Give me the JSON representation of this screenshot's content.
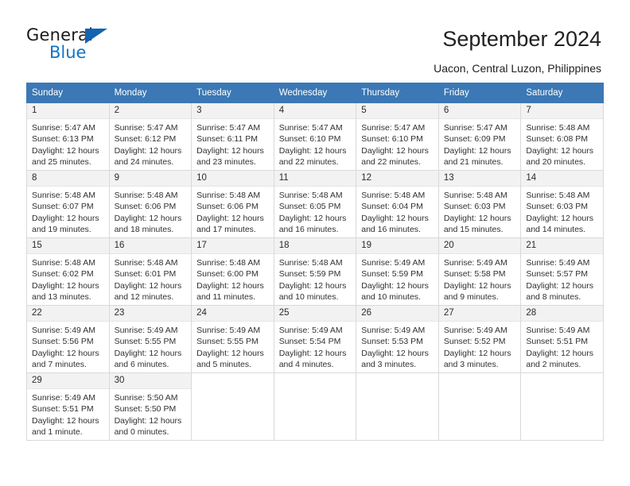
{
  "brand": {
    "name_top": "General",
    "name_bottom": "Blue",
    "accent_color": "#1273c7",
    "triangle_color": "#1263b0"
  },
  "header": {
    "title": "September 2024",
    "subtitle": "Uacon, Central Luzon, Philippines"
  },
  "calendar": {
    "header_color": "#3b78b5",
    "weekdays": [
      "Sunday",
      "Monday",
      "Tuesday",
      "Wednesday",
      "Thursday",
      "Friday",
      "Saturday"
    ],
    "weeks": [
      [
        {
          "day": "1",
          "sunrise": "Sunrise: 5:47 AM",
          "sunset": "Sunset: 6:13 PM",
          "daylight": "Daylight: 12 hours and 25 minutes."
        },
        {
          "day": "2",
          "sunrise": "Sunrise: 5:47 AM",
          "sunset": "Sunset: 6:12 PM",
          "daylight": "Daylight: 12 hours and 24 minutes."
        },
        {
          "day": "3",
          "sunrise": "Sunrise: 5:47 AM",
          "sunset": "Sunset: 6:11 PM",
          "daylight": "Daylight: 12 hours and 23 minutes."
        },
        {
          "day": "4",
          "sunrise": "Sunrise: 5:47 AM",
          "sunset": "Sunset: 6:10 PM",
          "daylight": "Daylight: 12 hours and 22 minutes."
        },
        {
          "day": "5",
          "sunrise": "Sunrise: 5:47 AM",
          "sunset": "Sunset: 6:10 PM",
          "daylight": "Daylight: 12 hours and 22 minutes."
        },
        {
          "day": "6",
          "sunrise": "Sunrise: 5:47 AM",
          "sunset": "Sunset: 6:09 PM",
          "daylight": "Daylight: 12 hours and 21 minutes."
        },
        {
          "day": "7",
          "sunrise": "Sunrise: 5:48 AM",
          "sunset": "Sunset: 6:08 PM",
          "daylight": "Daylight: 12 hours and 20 minutes."
        }
      ],
      [
        {
          "day": "8",
          "sunrise": "Sunrise: 5:48 AM",
          "sunset": "Sunset: 6:07 PM",
          "daylight": "Daylight: 12 hours and 19 minutes."
        },
        {
          "day": "9",
          "sunrise": "Sunrise: 5:48 AM",
          "sunset": "Sunset: 6:06 PM",
          "daylight": "Daylight: 12 hours and 18 minutes."
        },
        {
          "day": "10",
          "sunrise": "Sunrise: 5:48 AM",
          "sunset": "Sunset: 6:06 PM",
          "daylight": "Daylight: 12 hours and 17 minutes."
        },
        {
          "day": "11",
          "sunrise": "Sunrise: 5:48 AM",
          "sunset": "Sunset: 6:05 PM",
          "daylight": "Daylight: 12 hours and 16 minutes."
        },
        {
          "day": "12",
          "sunrise": "Sunrise: 5:48 AM",
          "sunset": "Sunset: 6:04 PM",
          "daylight": "Daylight: 12 hours and 16 minutes."
        },
        {
          "day": "13",
          "sunrise": "Sunrise: 5:48 AM",
          "sunset": "Sunset: 6:03 PM",
          "daylight": "Daylight: 12 hours and 15 minutes."
        },
        {
          "day": "14",
          "sunrise": "Sunrise: 5:48 AM",
          "sunset": "Sunset: 6:03 PM",
          "daylight": "Daylight: 12 hours and 14 minutes."
        }
      ],
      [
        {
          "day": "15",
          "sunrise": "Sunrise: 5:48 AM",
          "sunset": "Sunset: 6:02 PM",
          "daylight": "Daylight: 12 hours and 13 minutes."
        },
        {
          "day": "16",
          "sunrise": "Sunrise: 5:48 AM",
          "sunset": "Sunset: 6:01 PM",
          "daylight": "Daylight: 12 hours and 12 minutes."
        },
        {
          "day": "17",
          "sunrise": "Sunrise: 5:48 AM",
          "sunset": "Sunset: 6:00 PM",
          "daylight": "Daylight: 12 hours and 11 minutes."
        },
        {
          "day": "18",
          "sunrise": "Sunrise: 5:48 AM",
          "sunset": "Sunset: 5:59 PM",
          "daylight": "Daylight: 12 hours and 10 minutes."
        },
        {
          "day": "19",
          "sunrise": "Sunrise: 5:49 AM",
          "sunset": "Sunset: 5:59 PM",
          "daylight": "Daylight: 12 hours and 10 minutes."
        },
        {
          "day": "20",
          "sunrise": "Sunrise: 5:49 AM",
          "sunset": "Sunset: 5:58 PM",
          "daylight": "Daylight: 12 hours and 9 minutes."
        },
        {
          "day": "21",
          "sunrise": "Sunrise: 5:49 AM",
          "sunset": "Sunset: 5:57 PM",
          "daylight": "Daylight: 12 hours and 8 minutes."
        }
      ],
      [
        {
          "day": "22",
          "sunrise": "Sunrise: 5:49 AM",
          "sunset": "Sunset: 5:56 PM",
          "daylight": "Daylight: 12 hours and 7 minutes."
        },
        {
          "day": "23",
          "sunrise": "Sunrise: 5:49 AM",
          "sunset": "Sunset: 5:55 PM",
          "daylight": "Daylight: 12 hours and 6 minutes."
        },
        {
          "day": "24",
          "sunrise": "Sunrise: 5:49 AM",
          "sunset": "Sunset: 5:55 PM",
          "daylight": "Daylight: 12 hours and 5 minutes."
        },
        {
          "day": "25",
          "sunrise": "Sunrise: 5:49 AM",
          "sunset": "Sunset: 5:54 PM",
          "daylight": "Daylight: 12 hours and 4 minutes."
        },
        {
          "day": "26",
          "sunrise": "Sunrise: 5:49 AM",
          "sunset": "Sunset: 5:53 PM",
          "daylight": "Daylight: 12 hours and 3 minutes."
        },
        {
          "day": "27",
          "sunrise": "Sunrise: 5:49 AM",
          "sunset": "Sunset: 5:52 PM",
          "daylight": "Daylight: 12 hours and 3 minutes."
        },
        {
          "day": "28",
          "sunrise": "Sunrise: 5:49 AM",
          "sunset": "Sunset: 5:51 PM",
          "daylight": "Daylight: 12 hours and 2 minutes."
        }
      ],
      [
        {
          "day": "29",
          "sunrise": "Sunrise: 5:49 AM",
          "sunset": "Sunset: 5:51 PM",
          "daylight": "Daylight: 12 hours and 1 minute."
        },
        {
          "day": "30",
          "sunrise": "Sunrise: 5:50 AM",
          "sunset": "Sunset: 5:50 PM",
          "daylight": "Daylight: 12 hours and 0 minutes."
        },
        null,
        null,
        null,
        null,
        null
      ]
    ]
  }
}
